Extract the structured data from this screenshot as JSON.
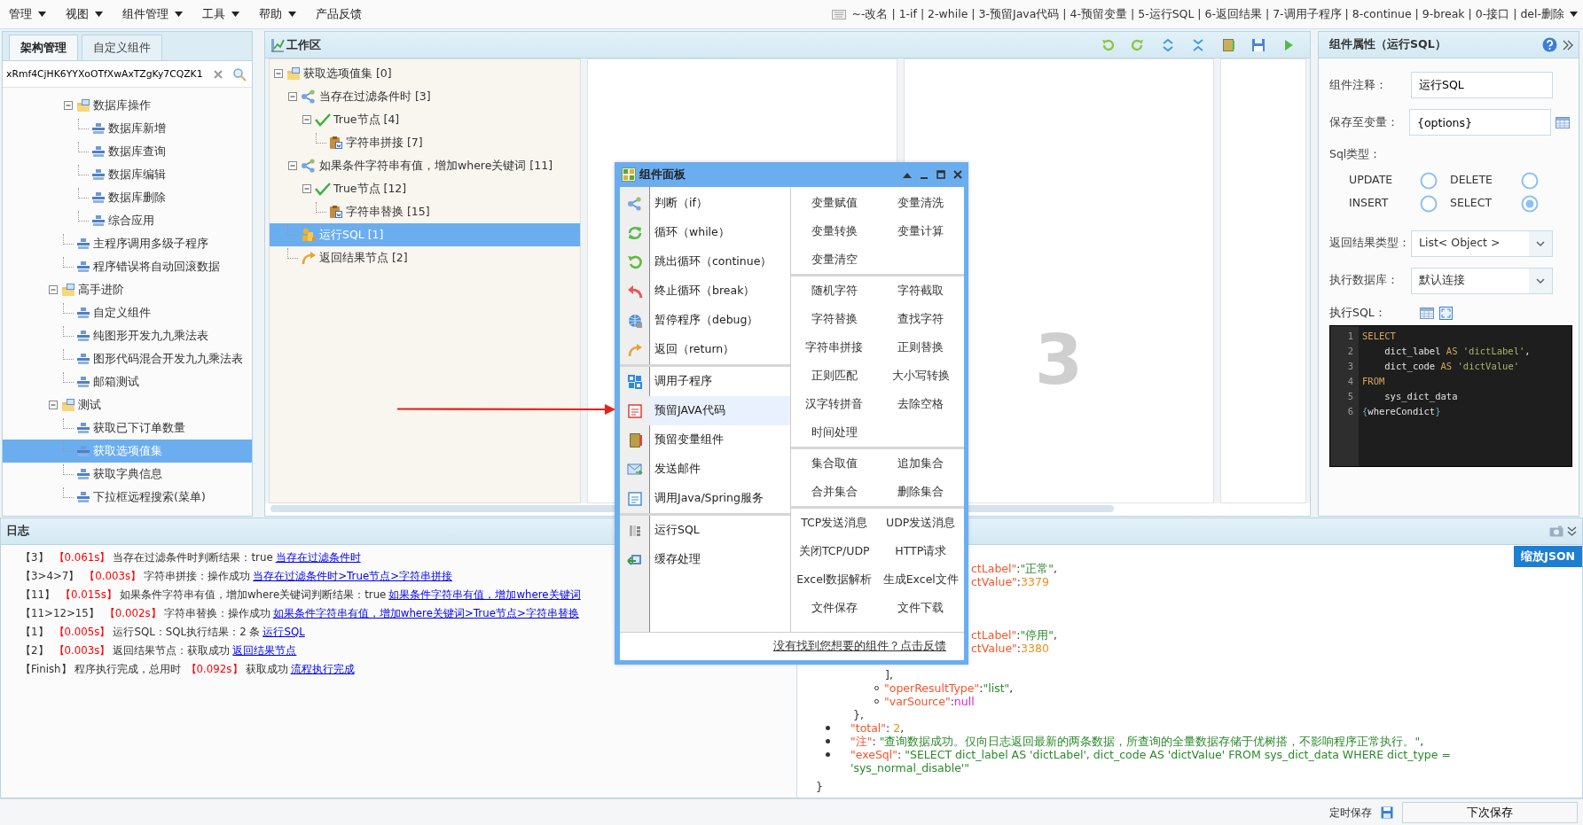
{
  "menu_bar": {
    "menus": [
      {
        "label": "管理",
        "has_dropdown": true
      },
      {
        "label": "视图",
        "has_dropdown": true
      },
      {
        "label": "组件管理",
        "has_dropdown": true
      },
      {
        "label": "工具",
        "has_dropdown": true
      },
      {
        "label": "帮助",
        "has_dropdown": true
      },
      {
        "label": "产品反馈",
        "has_dropdown": false
      }
    ],
    "shortcut_hint": "~-改名 | 1-if | 2-while | 3-预留Java代码 | 4-预留变量 | 5-运行SQL | 6-返回结果 | 7-调用子程序 | 8-continue | 9-break | 0-接口 | del-删除"
  },
  "left_panel": {
    "tabs": [
      {
        "label": "架构管理",
        "selected": true
      },
      {
        "label": "自定义组件",
        "selected": false
      }
    ],
    "search": {
      "value": "xRmf4CjHK6YYXoOTfXwAxTZgKy7CQZK1"
    },
    "tree": [
      {
        "kind": "hidden",
        "children": [
          {
            "kind": "folder",
            "label": "数据库操作",
            "expanded": true,
            "selected": false,
            "children": [
              {
                "kind": "leaf",
                "label": "数据库新增",
                "selected": false
              },
              {
                "kind": "leaf",
                "label": "数据库查询",
                "selected": false
              },
              {
                "kind": "leaf",
                "label": "数据库编辑",
                "selected": false
              },
              {
                "kind": "leaf",
                "label": "数据库删除",
                "selected": false
              },
              {
                "kind": "leaf",
                "label": "综合应用",
                "selected": false
              }
            ]
          },
          {
            "kind": "leaf",
            "label": "主程序调用多级子程序",
            "selected": false
          },
          {
            "kind": "leaf",
            "label": "程序错误将自动回滚数据",
            "selected": false
          }
        ]
      },
      {
        "kind": "folder",
        "label": "高手进阶",
        "expanded": true,
        "selected": false,
        "children": [
          {
            "kind": "leaf",
            "label": "自定义组件",
            "selected": false
          },
          {
            "kind": "leaf",
            "label": "纯图形开发九九乘法表",
            "selected": false
          },
          {
            "kind": "leaf",
            "label": "图形代码混合开发九九乘法表",
            "selected": false
          },
          {
            "kind": "leaf",
            "label": "邮箱测试",
            "selected": false
          }
        ]
      },
      {
        "kind": "folder",
        "label": "测试",
        "expanded": true,
        "selected": false,
        "children": [
          {
            "kind": "leaf",
            "label": "获取已下订单数量",
            "selected": false
          },
          {
            "kind": "leaf",
            "label": "获取选项值集",
            "selected": true
          },
          {
            "kind": "leaf",
            "label": "获取字典信息",
            "selected": false
          },
          {
            "kind": "leaf",
            "label": "下拉框远程搜索(菜单)",
            "selected": false
          }
        ]
      }
    ]
  },
  "workspace": {
    "title": "工作区",
    "canvas_number": "3",
    "tree": [
      {
        "kind": "root",
        "label": "获取选项值集 [0]",
        "expanded": true,
        "selected": false,
        "children": [
          {
            "kind": "branch",
            "label": "当存在过滤条件时 [3]",
            "expanded": true,
            "selected": false,
            "children": [
              {
                "kind": "true",
                "label": "True节点 [4]",
                "expanded": true,
                "selected": false,
                "children": [
                  {
                    "kind": "clipboard",
                    "label": "字符串拼接 [7]",
                    "selected": false
                  }
                ]
              }
            ]
          },
          {
            "kind": "branch",
            "label": "如果条件字符串有值，增加where关键词 [11]",
            "expanded": true,
            "selected": false,
            "children": [
              {
                "kind": "true",
                "label": "True节点 [12]",
                "expanded": true,
                "selected": false,
                "children": [
                  {
                    "kind": "clipboard",
                    "label": "字符串替换 [15]",
                    "selected": false
                  }
                ]
              }
            ]
          },
          {
            "kind": "sql",
            "label": "运行SQL [1]",
            "selected": true
          },
          {
            "kind": "return",
            "label": "返回结果节点 [2]",
            "selected": false
          }
        ]
      }
    ]
  },
  "component_panel": {
    "title": "组件面板",
    "left_groups": [
      [
        {
          "label": "判断（if）",
          "selected": false
        },
        {
          "label": "循环（while）",
          "selected": false
        },
        {
          "label": "跳出循环（continue）",
          "selected": false
        },
        {
          "label": "终止循环（break）",
          "selected": false
        },
        {
          "label": "暂停程序（debug）",
          "selected": false
        },
        {
          "label": "返回（return）",
          "selected": false
        }
      ],
      [
        {
          "label": "调用子程序",
          "selected": false
        },
        {
          "label": "预留JAVA代码",
          "selected": true
        },
        {
          "label": "预留变量组件",
          "selected": false
        },
        {
          "label": "发送邮件",
          "selected": false
        },
        {
          "label": "调用Java/Spring服务",
          "selected": false
        }
      ],
      [
        {
          "label": "运行SQL",
          "selected": false
        },
        {
          "label": "缓存处理",
          "selected": false
        }
      ]
    ],
    "right_groups": [
      [
        "变量赋值",
        "变量清洗",
        "变量转换",
        "变量计算",
        "变量清空"
      ],
      [
        "随机字符",
        "字符截取",
        "字符替换",
        "查找字符",
        "字符串拼接",
        "正则替换",
        "正则匹配",
        "大小写转换",
        "汉字转拼音",
        "去除空格",
        "时间处理"
      ],
      [
        "集合取值",
        "追加集合",
        "合并集合",
        "删除集合"
      ],
      [
        "TCP发送消息",
        "UDP发送消息",
        "关闭TCP/UDP",
        "HTTP请求",
        "Excel数据解析",
        "生成Excel文件",
        "文件保存",
        "文件下载"
      ]
    ],
    "feedback_link": "没有找到您想要的组件？点击反馈"
  },
  "properties": {
    "title": "组件属性（运行SQL）",
    "fields": [
      {
        "kind": "text",
        "label": "组件注释：",
        "value": "运行SQL"
      },
      {
        "kind": "picker",
        "label": "保存至变量：",
        "value": "{options}"
      },
      {
        "kind": "radio_group",
        "label": "Sql类型：",
        "options": [
          {
            "label": "UPDATE",
            "selected": false
          },
          {
            "label": "DELETE",
            "selected": false
          },
          {
            "label": "INSERT",
            "selected": false
          },
          {
            "label": "SELECT",
            "selected": true
          }
        ]
      },
      {
        "kind": "select",
        "label": "返回结果类型：",
        "value": "List< Object >"
      },
      {
        "kind": "select",
        "label": "执行数据库：",
        "value": "默认连接"
      }
    ],
    "sql_label": "执行SQL：",
    "sql_lines": [
      {
        "number": "1",
        "tokens": [
          {
            "kind": "keyword",
            "text": "SELECT"
          }
        ]
      },
      {
        "number": "2",
        "tokens": [
          {
            "kind": "ident",
            "text": "    dict_label "
          },
          {
            "kind": "keyword",
            "text": "AS "
          },
          {
            "kind": "string",
            "text": "'dictLabel'"
          },
          {
            "kind": "ident",
            "text": ","
          }
        ]
      },
      {
        "number": "3",
        "tokens": [
          {
            "kind": "ident",
            "text": "    dict_code "
          },
          {
            "kind": "keyword",
            "text": "AS "
          },
          {
            "kind": "string",
            "text": "'dictValue'"
          }
        ]
      },
      {
        "number": "4",
        "tokens": [
          {
            "kind": "keyword",
            "text": "FROM"
          }
        ]
      },
      {
        "number": "5",
        "tokens": [
          {
            "kind": "ident",
            "text": "    sys_dict_data"
          }
        ]
      },
      {
        "number": "6",
        "tokens": [
          {
            "kind": "brace",
            "text": "{"
          },
          {
            "kind": "ident",
            "text": "whereCondict"
          },
          {
            "kind": "brace",
            "text": "}"
          }
        ]
      }
    ]
  },
  "log": {
    "title": "日志",
    "lines": [
      [
        {
          "kind": "plain",
          "text": "【3】"
        },
        {
          "kind": "time",
          "text": "【0.061s】"
        },
        {
          "kind": "plain",
          "text": "当存在过滤条件时判断结果：true"
        },
        {
          "kind": "link",
          "text": "当存在过滤条件时"
        }
      ],
      [
        {
          "kind": "plain",
          "text": "【3>4>7】"
        },
        {
          "kind": "time",
          "text": "【0.003s】"
        },
        {
          "kind": "plain",
          "text": "字符串拼接：操作成功"
        },
        {
          "kind": "link",
          "text": "当存在过滤条件时>True节点>字符串拼接"
        }
      ],
      [
        {
          "kind": "plain",
          "text": "【11】"
        },
        {
          "kind": "time",
          "text": "【0.015s】"
        },
        {
          "kind": "plain",
          "text": "如果条件字符串有值，增加where关键词判断结果：true"
        },
        {
          "kind": "link",
          "text": "如果条件字符串有值，增加where关键词"
        }
      ],
      [
        {
          "kind": "plain",
          "text": "【11>12>15】"
        },
        {
          "kind": "time",
          "text": "【0.002s】"
        },
        {
          "kind": "plain",
          "text": "字符串替换：操作成功"
        },
        {
          "kind": "link",
          "text": "如果条件字符串有值，增加where关键词>True节点>字符串替换"
        }
      ],
      [
        {
          "kind": "plain",
          "text": "【1】"
        },
        {
          "kind": "time",
          "text": "【0.005s】"
        },
        {
          "kind": "plain",
          "text": "运行SQL：SQL执行结果：2 条"
        },
        {
          "kind": "link",
          "text": "运行SQL"
        }
      ],
      [
        {
          "kind": "plain",
          "text": "【2】"
        },
        {
          "kind": "time",
          "text": "【0.003s】"
        },
        {
          "kind": "plain",
          "text": "返回结果节点：获取成功"
        },
        {
          "kind": "link",
          "text": "返回结果节点"
        }
      ],
      [
        {
          "kind": "plain",
          "text": "【Finish】"
        },
        {
          "kind": "plain",
          "text": "程序执行完成，总用时"
        },
        {
          "kind": "time",
          "text": "【0.092s】"
        },
        {
          "kind": "plain",
          "text": "获取成功"
        },
        {
          "kind": "link",
          "text": "流程执行完成"
        }
      ]
    ]
  },
  "json_view": {
    "zoom_button": "缩放JSON",
    "fragment_groups": [
      [
        {
          "key": "ctLabel\"",
          "sep": ": ",
          "value": "\"正常\"",
          "kind": "string",
          "tail": ","
        },
        {
          "key": "ctValue\"",
          "sep": ": ",
          "value": "3379",
          "kind": "number"
        }
      ],
      [
        {
          "key": "ctLabel\"",
          "sep": ": ",
          "value": "\"停用\"",
          "kind": "string",
          "tail": ","
        },
        {
          "key": "ctValue\"",
          "sep": ": ",
          "value": "3380",
          "kind": "number"
        }
      ]
    ],
    "inner_close": "],",
    "inner_items": [
      {
        "key": "\"operResultType\"",
        "sep": ": ",
        "value": "\"list\"",
        "kind": "string",
        "tail": ","
      },
      {
        "key": "\"varSource\"",
        "sep": ": ",
        "value": "null",
        "kind": "null"
      }
    ],
    "outer_close": "},",
    "items": [
      {
        "key": "\"total\"",
        "sep": ": ",
        "value": "2",
        "kind": "number",
        "tail": ","
      },
      {
        "key": "\"注\"",
        "sep": ": ",
        "value": "\"查询数据成功。仅向日志返回最新的两条数据，所查询的全量数据存储于优树搭，不影响程序正常执行。\"",
        "kind": "string",
        "tail": ","
      },
      {
        "key": "\"exeSql\"",
        "sep": ": ",
        "value": "\"SELECT  dict_label AS 'dictLabel',  dict_code AS 'dictValue'  FROM  sys_dict_data   WHERE dict_type = 'sys_normal_disable'\"",
        "kind": "string"
      }
    ],
    "end": "}"
  },
  "status_bar": {
    "label": "定时保存",
    "button": "下次保存"
  }
}
